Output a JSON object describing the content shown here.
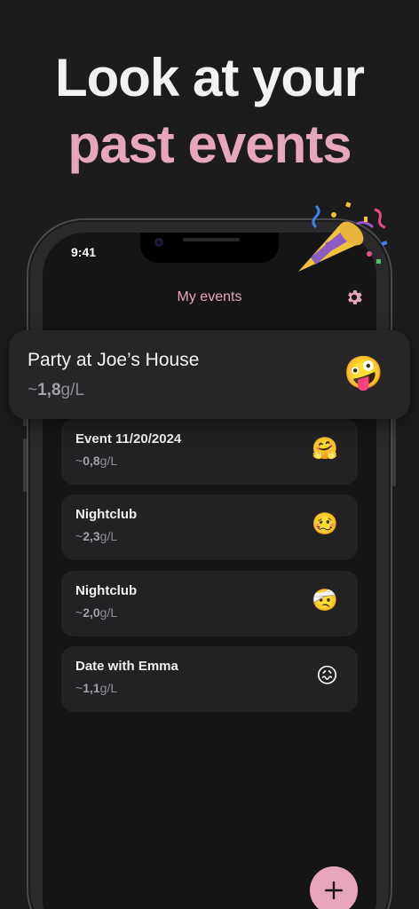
{
  "headline": {
    "line1": "Look at your",
    "line2": "past events"
  },
  "status_bar": {
    "time": "9:41"
  },
  "nav": {
    "title": "My events",
    "settings_icon": "gear-icon"
  },
  "featured_event": {
    "title": "Party at Joe’s House",
    "value_prefix": "~",
    "value": "1,8",
    "unit": "g/L",
    "emoji": "🤪"
  },
  "events": [
    {
      "title": "Event 11/20/2024",
      "value_prefix": "~",
      "value": "0,8",
      "unit": "g/L",
      "emoji": "🤗"
    },
    {
      "title": "Nightclub",
      "value_prefix": "~",
      "value": "2,3",
      "unit": "g/L",
      "emoji": "🥴"
    },
    {
      "title": "Nightclub",
      "value_prefix": "~",
      "value": "2,0",
      "unit": "g/L",
      "emoji": "🤕"
    },
    {
      "title": "Date with Emma",
      "value_prefix": "~",
      "value": "1,1",
      "unit": "g/L",
      "emoji": "😖"
    }
  ],
  "fab": {
    "icon": "plus-icon"
  },
  "decoration": {
    "icon": "party-popper-icon"
  },
  "colors": {
    "accent": "#e8a6bd",
    "background": "#1c1c1d",
    "card": "#222224"
  }
}
